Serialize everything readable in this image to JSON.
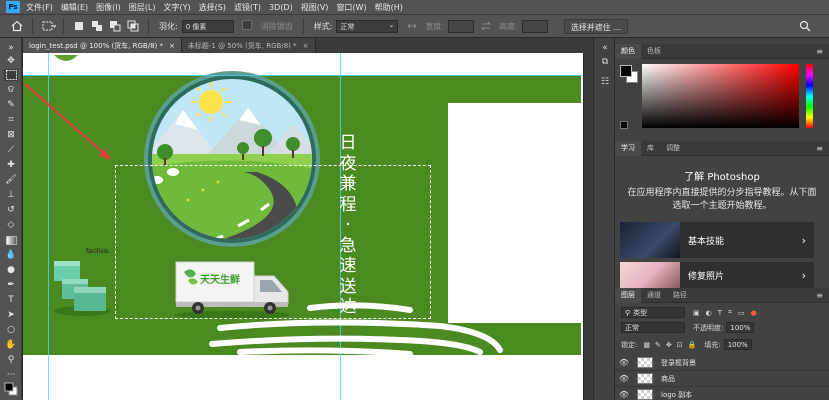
{
  "menu": {
    "logo": "Ps",
    "items": [
      "文件(F)",
      "编辑(E)",
      "图像(I)",
      "图层(L)",
      "文字(Y)",
      "选择(S)",
      "滤镜(T)",
      "3D(D)",
      "视图(V)",
      "窗口(W)",
      "帮助(H)"
    ]
  },
  "options": {
    "feather_label": "羽化:",
    "feather_value": "0 像素",
    "antialias_label": "消除锯齿",
    "style_label": "样式:",
    "style_value": "正常",
    "width_label": "宽度:",
    "height_label": "高度:",
    "select_mask_button": "选择并遮住 ..."
  },
  "tabs": [
    {
      "label": "login_test.psd @ 100% (货车, RGB/8) *",
      "close": "×"
    },
    {
      "label": "未标题-1 @ 50% (货车, RGB/8) *",
      "close": "×"
    }
  ],
  "canvas": {
    "slogan_chars": [
      "日",
      "夜",
      "兼",
      "程",
      "·",
      "急",
      "速",
      "送",
      "达"
    ],
    "stray_text": "facilisis.",
    "truck_logo_text": "天天生鲜"
  },
  "color_panel": {
    "tabs": [
      "颜色",
      "色板"
    ],
    "foreground": "#000000",
    "background": "#ffffff"
  },
  "learn_panel": {
    "tabs": [
      "学习",
      "库",
      "调整"
    ],
    "title": "了解 Photoshop",
    "description": "在应用程序内直接提供的分步指导教程。从下面选取一个主题开始教程。",
    "cards": [
      {
        "label": "基本技能",
        "chevron": "›"
      },
      {
        "label": "修复照片",
        "chevron": "›"
      }
    ]
  },
  "layers_panel": {
    "tabs": [
      "图层",
      "通道",
      "路径"
    ],
    "filter_label": "类型",
    "blend_mode": "正常",
    "opacity_label": "不透明度:",
    "opacity_value": "100%",
    "lock_label": "锁定:",
    "fill_label": "填充:",
    "fill_value": "100%",
    "layers": [
      {
        "name": "登录框背景"
      },
      {
        "name": "商品"
      },
      {
        "name": "logo 副本"
      }
    ]
  },
  "colors": {
    "accent": "#31a8ff",
    "canvas_green": "#4a8a20",
    "guide": "#47d4ff",
    "annotation_arrow": "#e53935"
  }
}
